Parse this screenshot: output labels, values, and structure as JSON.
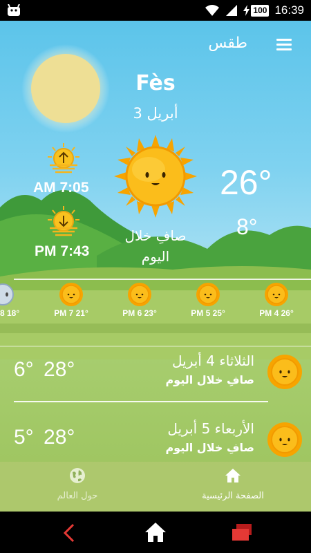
{
  "status_bar": {
    "time": "16:39",
    "battery": "100"
  },
  "app": {
    "title": "طقس"
  },
  "location": {
    "city": "Fès",
    "date": "3 أبريل"
  },
  "sun": {
    "sunrise": "AM 7:05",
    "sunset": "PM 7:43"
  },
  "current": {
    "temp": "26°",
    "low": "8°",
    "condition_line1": "صافِ خلال",
    "condition_line2": "اليوم"
  },
  "hourly": [
    {
      "label": "8 18°"
    },
    {
      "label": "PM 7 21°"
    },
    {
      "label": "PM 6 23°"
    },
    {
      "label": "PM 5 25°"
    },
    {
      "label": "PM 4 26°"
    }
  ],
  "daily": [
    {
      "temps": "6° 28°",
      "title": "الثلاثاء 4 أبريل",
      "condition": "صافِ خلال اليوم"
    },
    {
      "temps": "5° 28°",
      "title": "الأربعاء 5 أبريل",
      "condition": "صافِ خلال اليوم"
    }
  ],
  "nav": {
    "world_label": "حول العالم",
    "home_label": "الصفحة الرئيسية"
  },
  "colors": {
    "sky": "#5cc4ea",
    "grass": "#9cc35c",
    "sun": "#ffb300",
    "system_accent": "#e53935"
  }
}
